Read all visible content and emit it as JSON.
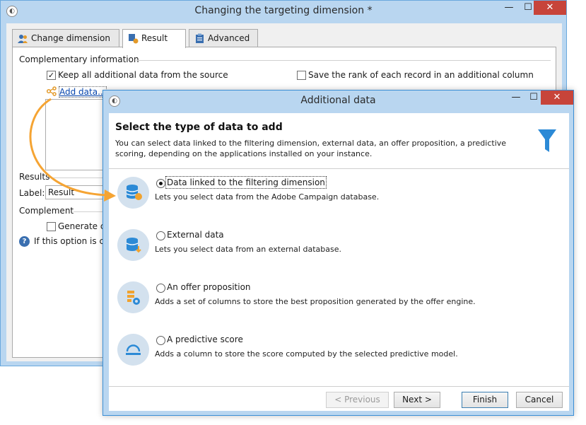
{
  "back_window": {
    "title": "Changing the targeting dimension *",
    "controls": {
      "minimize": "—",
      "maximize": "☐",
      "close": "✕"
    },
    "tabs": [
      {
        "label": "Change dimension",
        "icon": "users-icon"
      },
      {
        "label": "Result",
        "icon": "result-gear-icon"
      },
      {
        "label": "Advanced",
        "icon": "clipboard-icon"
      }
    ],
    "complementary_label": "Complementary information",
    "keep_data_label": "Keep all additional data from the source",
    "keep_data_checked": true,
    "save_rank_label": "Save the rank of each record in an additional column",
    "save_rank_checked": false,
    "add_data_link": "Add data...",
    "results_label": "Results",
    "label_field_label": "Label:",
    "label_field_value": "Result",
    "complement_label": "Complement",
    "generate_label": "Generate co",
    "generate_checked": false,
    "help_text": "If this option is che"
  },
  "dialog": {
    "title": "Additional data",
    "controls": {
      "minimize": "—",
      "maximize": "☐",
      "close": "✕"
    },
    "header_title": "Select the type of data to add",
    "header_desc": "You can select data linked to the filtering dimension, external data, an offer proposition, a predictive scoring, depending on the applications installed on your instance.",
    "header_icon": "funnel-icon",
    "options": [
      {
        "label": "Data linked to the filtering dimension",
        "desc": "Lets you select data from the Adobe Campaign database.",
        "selected": true,
        "icon": "database-linked-icon"
      },
      {
        "label": "External data",
        "desc": "Lets you select data from an external database.",
        "selected": false,
        "icon": "database-import-icon"
      },
      {
        "label": "An offer proposition",
        "desc": "Adds a set of columns to store the best proposition generated by the offer engine.",
        "selected": false,
        "icon": "offer-gear-icon"
      },
      {
        "label": "A predictive score",
        "desc": "Adds a column to store the score computed by the selected predictive model.",
        "selected": false,
        "icon": "predictive-model-icon"
      }
    ],
    "buttons": {
      "previous": "< Previous",
      "next": "Next >",
      "finish": "Finish",
      "cancel": "Cancel"
    }
  },
  "colors": {
    "accent": "#3b8fd6",
    "arrow": "#f5a433",
    "close": "#c7443a"
  }
}
